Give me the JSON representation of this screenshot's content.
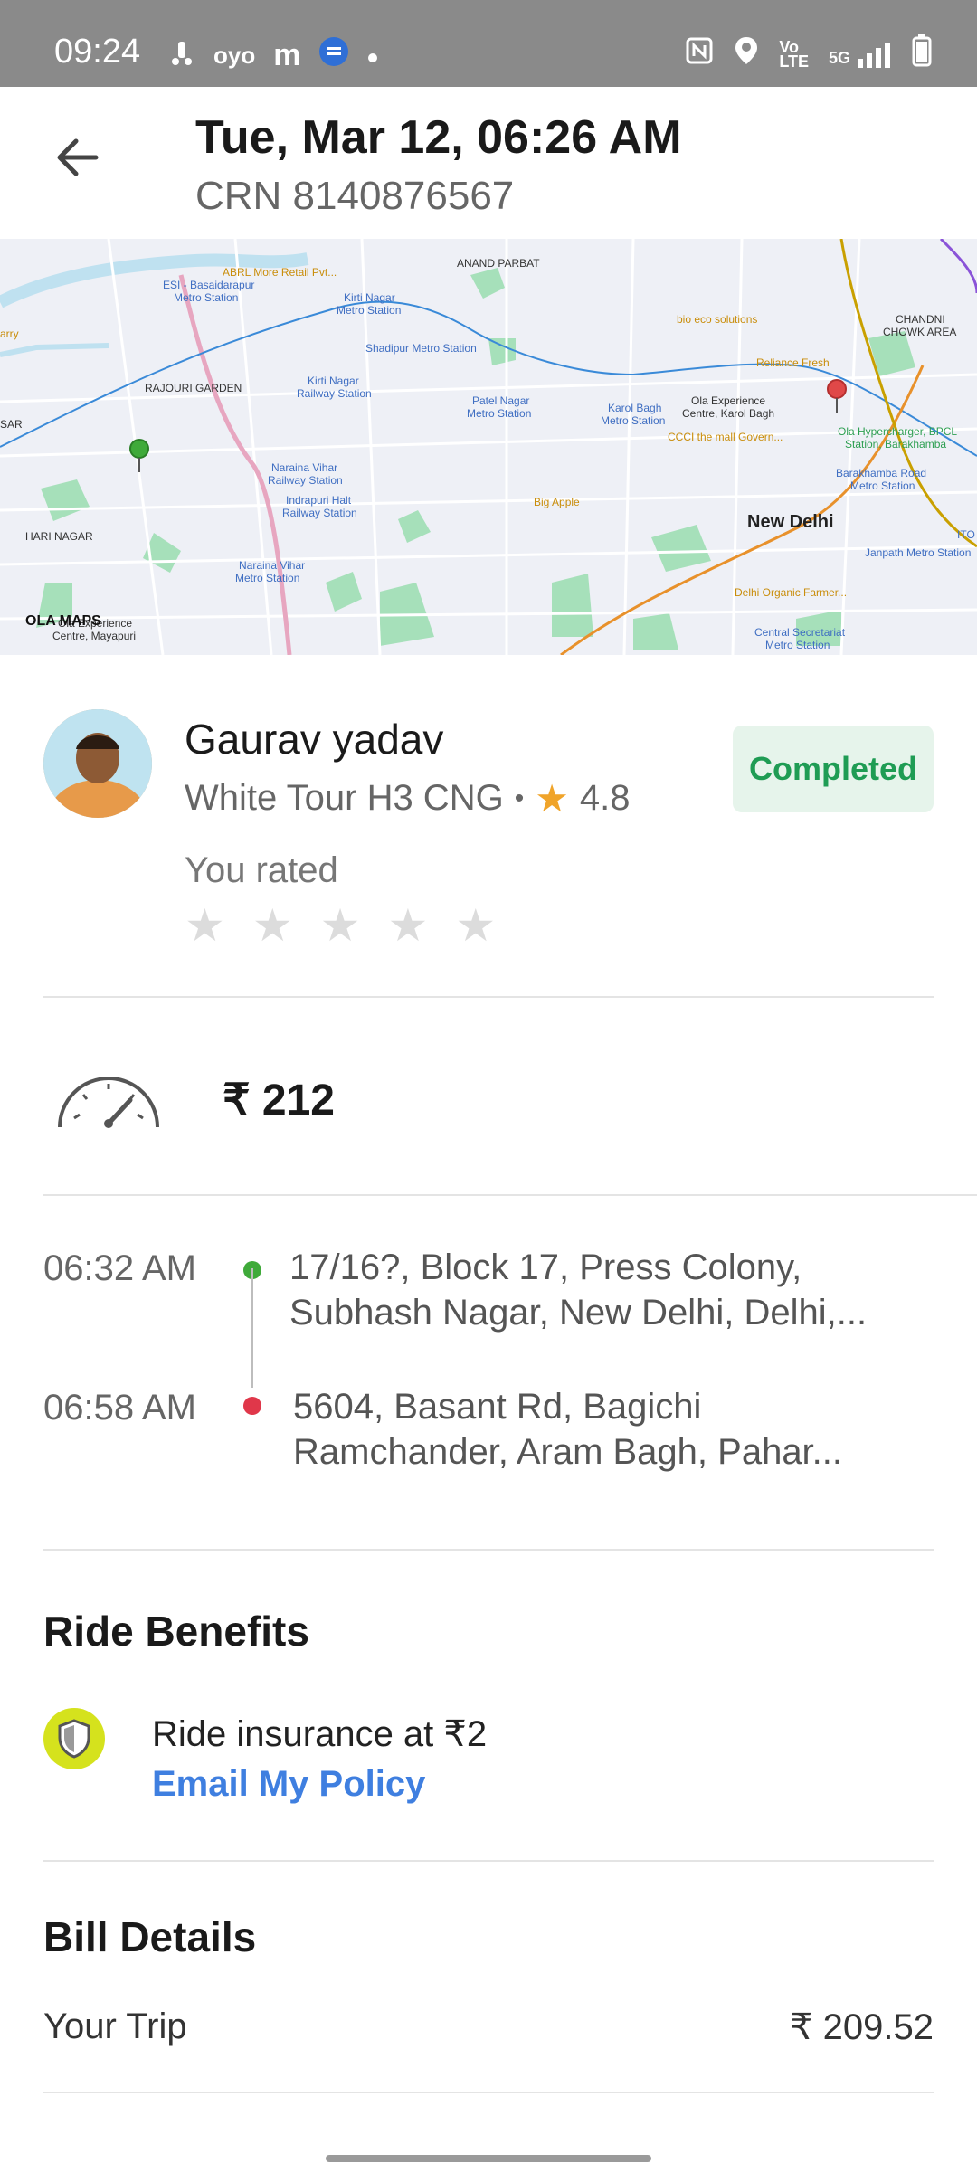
{
  "status_bar": {
    "time": "09:24",
    "network": "5G"
  },
  "header": {
    "title": "Tue, Mar 12, 06:26 AM",
    "crn": "CRN 8140876567"
  },
  "map": {
    "labels": {
      "anand_parbat": "ANAND PARBAT",
      "abrl": "ABRL More Retail Pvt...",
      "esi": "ESI - Basaidarapur",
      "esi2": "Metro Station",
      "kirti_nagar": "Kirti Nagar",
      "kirti_nagar2": "Metro Station",
      "shadipur": "Shadipur Metro Station",
      "bio_eco": "bio eco solutions",
      "chandni": "CHANDNI",
      "chandni2": "CHOWK AREA",
      "rajouri": "RAJOURI GARDEN",
      "kirti_rly": "Kirti Nagar",
      "kirti_rly2": "Railway Station",
      "patel_nagar": "Patel Nagar",
      "patel_nagar2": "Metro Station",
      "karol_bagh": "Karol Bagh",
      "karol_bagh2": "Metro Station",
      "ola_exp": "Ola Experience",
      "ola_exp2": "Centre, Karol Bagh",
      "reliance": "Reliance Fresh",
      "ola_hyper": "Ola Hypercharger, BPCL",
      "ola_hyper2": "Station, Barakhamba",
      "cccl": "CCCI the mall Govern...",
      "naraina_rly": "Naraina Vihar",
      "naraina_rly2": "Railway Station",
      "barakhamba": "Barakhamba Road",
      "barakhamba2": "Metro Station",
      "indrapuri": "Indrapuri Halt",
      "indrapuri2": "Railway Station",
      "big_apple": "Big Apple",
      "new_delhi": "New Delhi",
      "hari_nagar": "HARI NAGAR",
      "naraina_metro": "Naraina Vihar",
      "naraina_metro2": "Metro Station",
      "janpath": "Janpath Metro Station",
      "delhi_organic": "Delhi Organic Farmer...",
      "central_sec": "Central Secretariat",
      "central_sec2": "Metro Station",
      "ola_mayapuri": "Ola Experience",
      "ola_mayapuri2": "Centre, Mayapuri",
      "arry": "arry",
      "sar": "SAR",
      "ito": "ITO",
      "brand": "OLA MAPS"
    }
  },
  "driver": {
    "name": "Gaurav yadav",
    "vehicle": "White Tour H3 CNG",
    "separator": "•",
    "rating": "4.8",
    "status": "Completed",
    "you_rated": "You rated"
  },
  "fare": {
    "amount": "₹ 212"
  },
  "trip": {
    "pickup_time": "06:32 AM",
    "pickup_address_line1": "17/16?, Block 17, Press Colony,",
    "pickup_address_line2": "Subhash Nagar, New Delhi, Delhi,...",
    "drop_time": "06:58 AM",
    "drop_address_line1": "5604, Basant Rd, Bagichi",
    "drop_address_line2": "Ramchander, Aram Bagh, Pahar..."
  },
  "benefits": {
    "title": "Ride Benefits",
    "insurance_label": "Ride insurance at ₹2",
    "email_policy": "Email My Policy"
  },
  "bill": {
    "title": "Bill Details",
    "your_trip_label": "Your Trip",
    "your_trip_value": "₹ 209.52"
  },
  "colors": {
    "completed_green": "#1f9c54",
    "link_blue": "#3f7fe0",
    "rating_star": "#f0a42a"
  }
}
